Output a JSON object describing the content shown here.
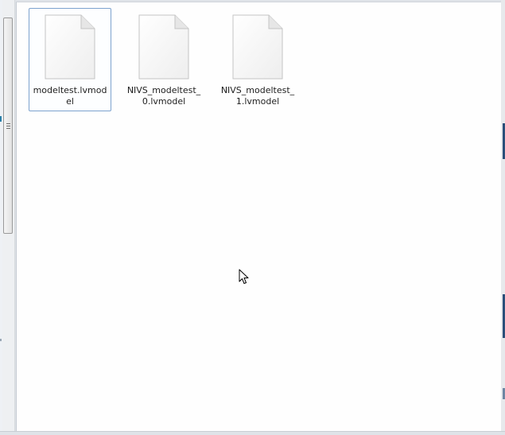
{
  "file_view": {
    "items": [
      {
        "name": "modeltest.lvmodel",
        "selected": true,
        "icon": "generic-file-icon"
      },
      {
        "name": "NIVS_modeltest_0.lvmodel",
        "selected": false,
        "icon": "generic-file-icon"
      },
      {
        "name": "NIVS_modeltest_1.lvmodel",
        "selected": false,
        "icon": "generic-file-icon"
      }
    ]
  },
  "colors": {
    "selection_border": "#7da2ce",
    "view_background": "#fefefe",
    "icon_fold": "#e6e6e6"
  }
}
